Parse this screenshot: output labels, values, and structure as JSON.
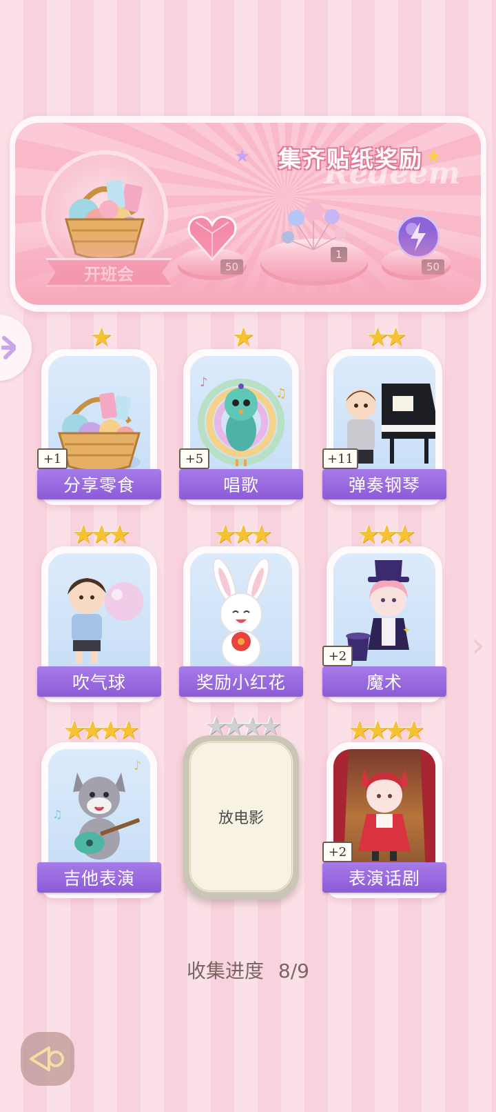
{
  "banner": {
    "title": "集齐贴纸奖励",
    "watermark": "Redeem",
    "event_label": "开班会",
    "rewards": [
      {
        "icon": "pink-heart-gem-icon",
        "count": "50"
      },
      {
        "icon": "balloon-bundle-icon",
        "count": "1"
      },
      {
        "icon": "purple-energy-orb-icon",
        "count": "50"
      }
    ]
  },
  "stickers": [
    {
      "name": "分享零食",
      "stars": 1,
      "bonus": "+1",
      "icon": "snack-basket-icon",
      "collected": true
    },
    {
      "name": "唱歌",
      "stars": 1,
      "bonus": "+5",
      "icon": "singing-peacock-icon",
      "collected": true
    },
    {
      "name": "弹奏钢琴",
      "stars": 2,
      "bonus": "+11",
      "icon": "piano-boy-icon",
      "collected": true
    },
    {
      "name": "吹气球",
      "stars": 3,
      "bonus": "",
      "icon": "balloon-boy-icon",
      "collected": true
    },
    {
      "name": "奖励小红花",
      "stars": 3,
      "bonus": "",
      "icon": "bunny-flower-icon",
      "collected": true
    },
    {
      "name": "魔术",
      "stars": 3,
      "bonus": "+2",
      "icon": "magician-girl-icon",
      "collected": true
    },
    {
      "name": "吉他表演",
      "stars": 4,
      "bonus": "",
      "icon": "guitar-wolf-icon",
      "collected": true
    },
    {
      "name": "放电影",
      "stars": 4,
      "bonus": "",
      "icon": "",
      "collected": false
    },
    {
      "name": "表演话剧",
      "stars": 4,
      "bonus": "+2",
      "icon": "theater-girl-icon",
      "collected": true
    }
  ],
  "progress": {
    "label": "收集进度",
    "value": "8/9"
  },
  "colors": {
    "accent_purple": "#9a6ae0",
    "star_gold": "#f6c232",
    "pink_bg": "#fbe1e7"
  }
}
